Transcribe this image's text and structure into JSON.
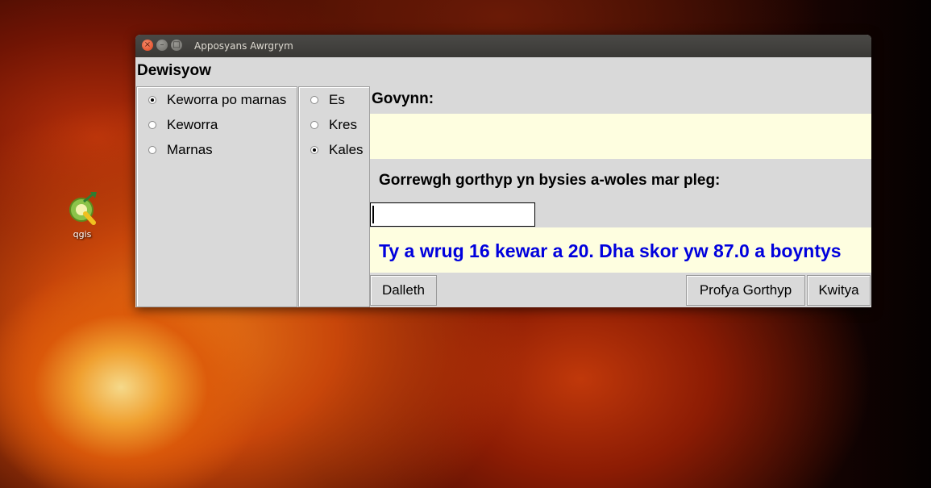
{
  "desktop": {
    "icon_label": "qgis"
  },
  "window": {
    "title": "Apposyans Awrgrym",
    "section_title": "Dewisyow"
  },
  "mode_options": [
    {
      "label": "Keworra po marnas",
      "selected": true
    },
    {
      "label": "Keworra",
      "selected": false
    },
    {
      "label": "Marnas",
      "selected": false
    }
  ],
  "level_options": [
    {
      "label": "Es",
      "selected": false
    },
    {
      "label": "Kres",
      "selected": false
    },
    {
      "label": "Kales",
      "selected": true
    }
  ],
  "question": {
    "label": "Govynn:",
    "text": ""
  },
  "answer": {
    "prompt": "Gorrewgh gorthyp yn bysies a-woles mar pleg:",
    "value": ""
  },
  "score": {
    "text": "Ty a wrug 16 kewar a 20. Dha skor yw 87.0 a boyntys",
    "color": "#0000dd"
  },
  "buttons": {
    "start": "Dalleth",
    "check": "Profya Gorthyp",
    "quit": "Kwitya"
  }
}
